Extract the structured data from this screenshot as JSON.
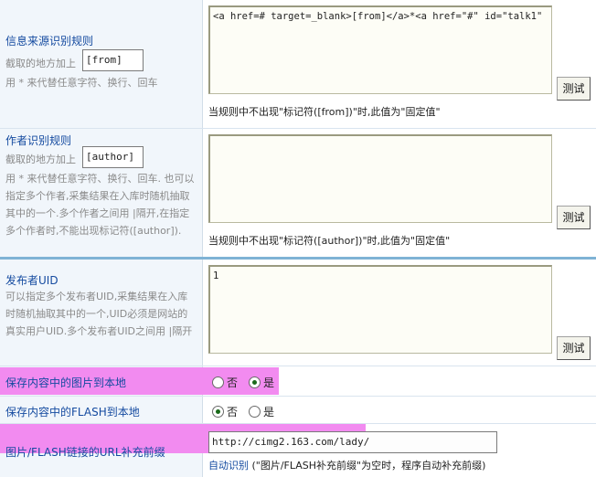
{
  "rows": {
    "source": {
      "title": "信息来源识别规则",
      "prefix_label": "截取的地方加上",
      "tag": "[from]",
      "hint": "用 * 来代替任意字符、换行、回车",
      "rule_value": "<a href=# target=_blank>[from]</a>*<a href=\"#\" id=\"talk1\"",
      "test_label": "测试",
      "note": "当规则中不出现\"标记符([from])\"时,此值为\"固定值\""
    },
    "author": {
      "title": "作者识别规则",
      "prefix_label": "截取的地方加上",
      "tag": "[author]",
      "hint": "用 * 来代替任意字符、换行、回车. 也可以指定多个作者,采集结果在入库时随机抽取其中的一个.多个作者之间用 |隔开,在指定多个作者时,不能出现标记符([author]).",
      "rule_value": "",
      "test_label": "测试",
      "note": "当规则中不出现\"标记符([author])\"时,此值为\"固定值\""
    },
    "uid": {
      "title": "发布者UID",
      "hint": "可以指定多个发布者UID,采集结果在入库时随机抽取其中的一个,UID必须是网站的真实用户UID.多个发布者UID之间用 |隔开",
      "rule_value": "1",
      "test_label": "测试"
    },
    "save_images": {
      "title": "保存内容中的图片到本地",
      "options": [
        "否",
        "是"
      ],
      "selected": "是"
    },
    "save_flash": {
      "title": "保存内容中的FLASH到本地",
      "options": [
        "否",
        "是"
      ],
      "selected": "否"
    },
    "url_prefix": {
      "title": "图片/FLASH链接的URL补充前缀",
      "value": "http://cimg2.163.com/lady/",
      "auto_link": "自动识别",
      "auto_note": " (\"图片/FLASH补充前缀\"为空时，程序自动补充前缀)"
    }
  },
  "colors": {
    "title_blue": "#154ba0",
    "highlight_pink": "#f28bf0",
    "label_bg": "#f1f6fb",
    "divider": "#7fb3d5"
  }
}
